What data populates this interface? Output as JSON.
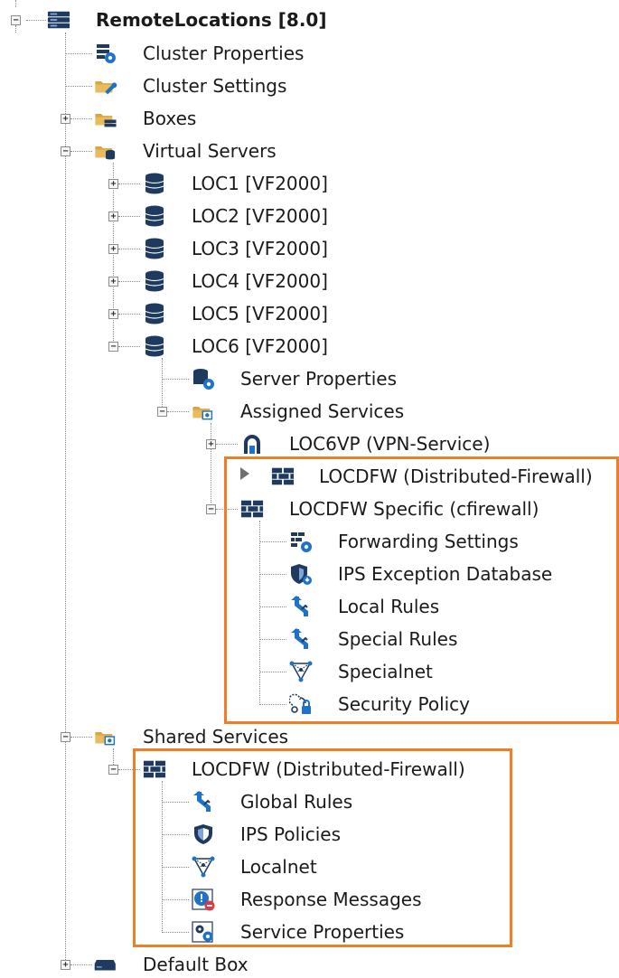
{
  "tree": {
    "root": {
      "label": "RemoteLocations [8.0]"
    },
    "cluster_properties": "Cluster Properties",
    "cluster_settings": "Cluster Settings",
    "boxes": "Boxes",
    "virtual_servers": "Virtual Servers",
    "locations": [
      "LOC1 [VF2000]",
      "LOC2 [VF2000]",
      "LOC3 [VF2000]",
      "LOC4 [VF2000]",
      "LOC5 [VF2000]",
      "LOC6 [VF2000]"
    ],
    "server_properties": "Server Properties",
    "assigned_services": "Assigned Services",
    "loc6vp": "LOC6VP (VPN-Service)",
    "locdfw_distributed": "LOCDFW (Distributed-Firewall)",
    "locdfw_specific": "LOCDFW Specific (cfirewall)",
    "specific_children": [
      "Forwarding Settings",
      "IPS Exception Database",
      "Local Rules",
      "Special Rules",
      "Specialnet",
      "Security Policy"
    ],
    "shared_services": "Shared Services",
    "shared_locdfw": "LOCDFW (Distributed-Firewall)",
    "shared_children": [
      "Global Rules",
      "IPS Policies",
      "Localnet",
      "Response Messages",
      "Service Properties"
    ],
    "default_box": "Default Box"
  },
  "colors": {
    "highlight": "#f07e26",
    "folder": "#d9a441",
    "navy": "#1f3a5f",
    "accent_blue": "#1e73c8"
  }
}
